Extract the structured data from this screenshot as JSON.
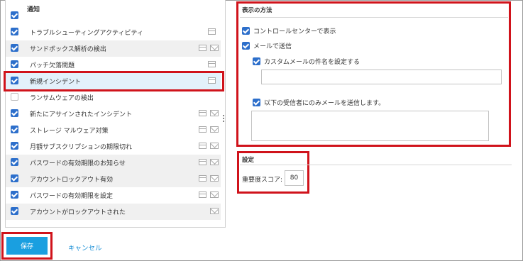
{
  "list": {
    "header": "通知",
    "rows": [
      {
        "label": "トラブルシューティングアクティビティ",
        "checked": true,
        "screen": true,
        "mail": false
      },
      {
        "label": "サンドボックス解析の検出",
        "checked": true,
        "screen": true,
        "mail": true
      },
      {
        "label": "パッチ欠落問題",
        "checked": true,
        "screen": true,
        "mail": false
      },
      {
        "label": "新規インシデント",
        "checked": true,
        "screen": true,
        "mail": false
      },
      {
        "label": "ランサムウェアの検出",
        "checked": false,
        "screen": false,
        "mail": false
      },
      {
        "label": "新たにアサインされたインシデント",
        "checked": true,
        "screen": true,
        "mail": true
      },
      {
        "label": "ストレージ マルウェア対策",
        "checked": true,
        "screen": true,
        "mail": true
      },
      {
        "label": "月額サブスクリプションの期限切れ",
        "checked": true,
        "screen": true,
        "mail": true
      },
      {
        "label": "パスワードの有効期限のお知らせ",
        "checked": true,
        "screen": true,
        "mail": true
      },
      {
        "label": "アカウントロックアウト有効",
        "checked": true,
        "screen": true,
        "mail": true
      },
      {
        "label": "パスワードの有効期限を設定",
        "checked": true,
        "screen": true,
        "mail": true
      },
      {
        "label": "アカウントがロックアウトされた",
        "checked": true,
        "screen": false,
        "mail": true
      }
    ]
  },
  "display": {
    "title": "表示の方法",
    "control_center_label": "コントロールセンターで表示",
    "send_mail_label": "メールで送信",
    "custom_subject_label": "カスタムメールの件名を設定する",
    "custom_subject_value": "",
    "recipients_only_label": "以下の受信者にのみメールを送信します。",
    "recipients_value": ""
  },
  "settings": {
    "title": "設定",
    "severity_label": "重要度スコア:",
    "severity_value": "80"
  },
  "actions": {
    "save_label": "保存",
    "cancel_label": "キャンセル"
  },
  "colors": {
    "accent": "#1a9fe0",
    "checkbox": "#2d6fcb",
    "highlight": "#d0131b"
  }
}
